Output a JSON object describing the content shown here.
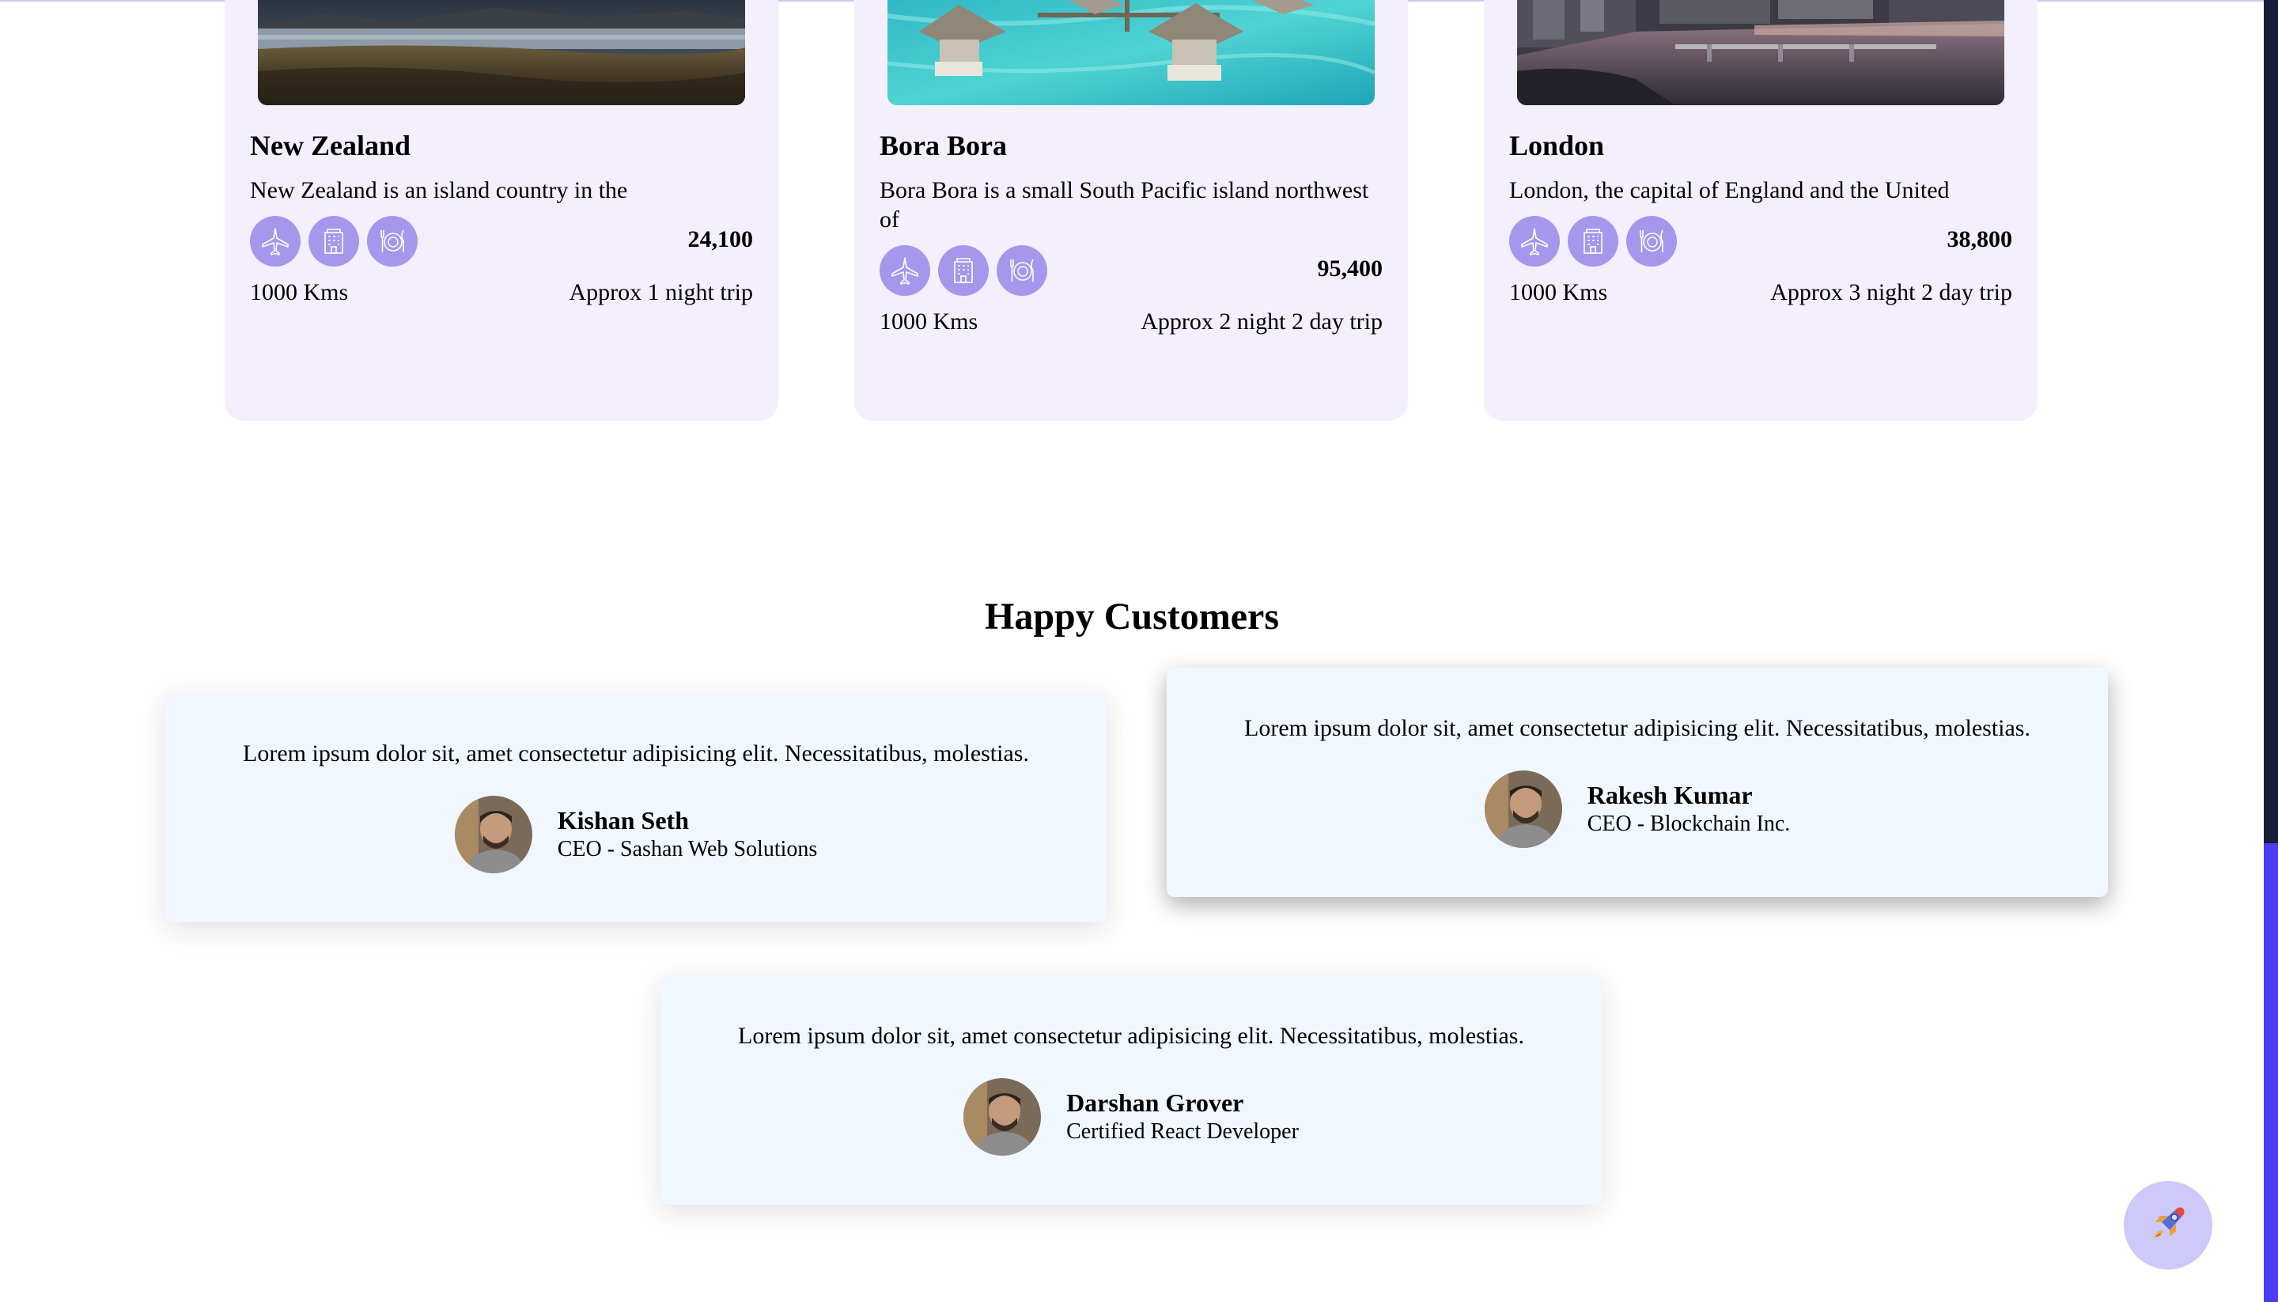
{
  "destinations": [
    {
      "name": "New Zealand",
      "description": "New Zealand is an island country in the",
      "price": "24,100",
      "distance": "1000 Kms",
      "trip": "Approx 1 night trip",
      "amenities": [
        "airplane-icon",
        "hotel-icon",
        "food-icon"
      ]
    },
    {
      "name": "Bora Bora",
      "description": "Bora Bora is a small South Pacific island northwest of",
      "price": "95,400",
      "distance": "1000 Kms",
      "trip": "Approx 2 night 2 day trip",
      "amenities": [
        "airplane-icon",
        "hotel-icon",
        "food-icon"
      ]
    },
    {
      "name": "London",
      "description": "London, the capital of England and the United",
      "price": "38,800",
      "distance": "1000 Kms",
      "trip": "Approx 3 night 2 day trip",
      "amenities": [
        "airplane-icon",
        "hotel-icon",
        "food-icon"
      ]
    }
  ],
  "testimonials_section": {
    "title": "Happy Customers",
    "items": [
      {
        "text": "Lorem ipsum dolor sit, amet consectetur adipisicing elit. Necessitatibus, molestias.",
        "name": "Kishan Seth",
        "role": "CEO - Sashan Web Solutions"
      },
      {
        "text": "Lorem ipsum dolor sit, amet consectetur adipisicing elit. Necessitatibus, molestias.",
        "name": "Rakesh Kumar",
        "role": "CEO - Blockchain Inc."
      },
      {
        "text": "Lorem ipsum dolor sit, amet consectetur adipisicing elit. Necessitatibus, molestias.",
        "name": "Darshan Grover",
        "role": "Certified React Developer"
      }
    ]
  },
  "colors": {
    "card_bg": "#f3effd",
    "amenity_bg": "#a597ec",
    "testimonial_bg": "#f0f7fe",
    "fab_bg": "#cfc9f9",
    "scroll_thumb": "#4b3ef0"
  },
  "fab": {
    "icon": "rocket-icon"
  }
}
